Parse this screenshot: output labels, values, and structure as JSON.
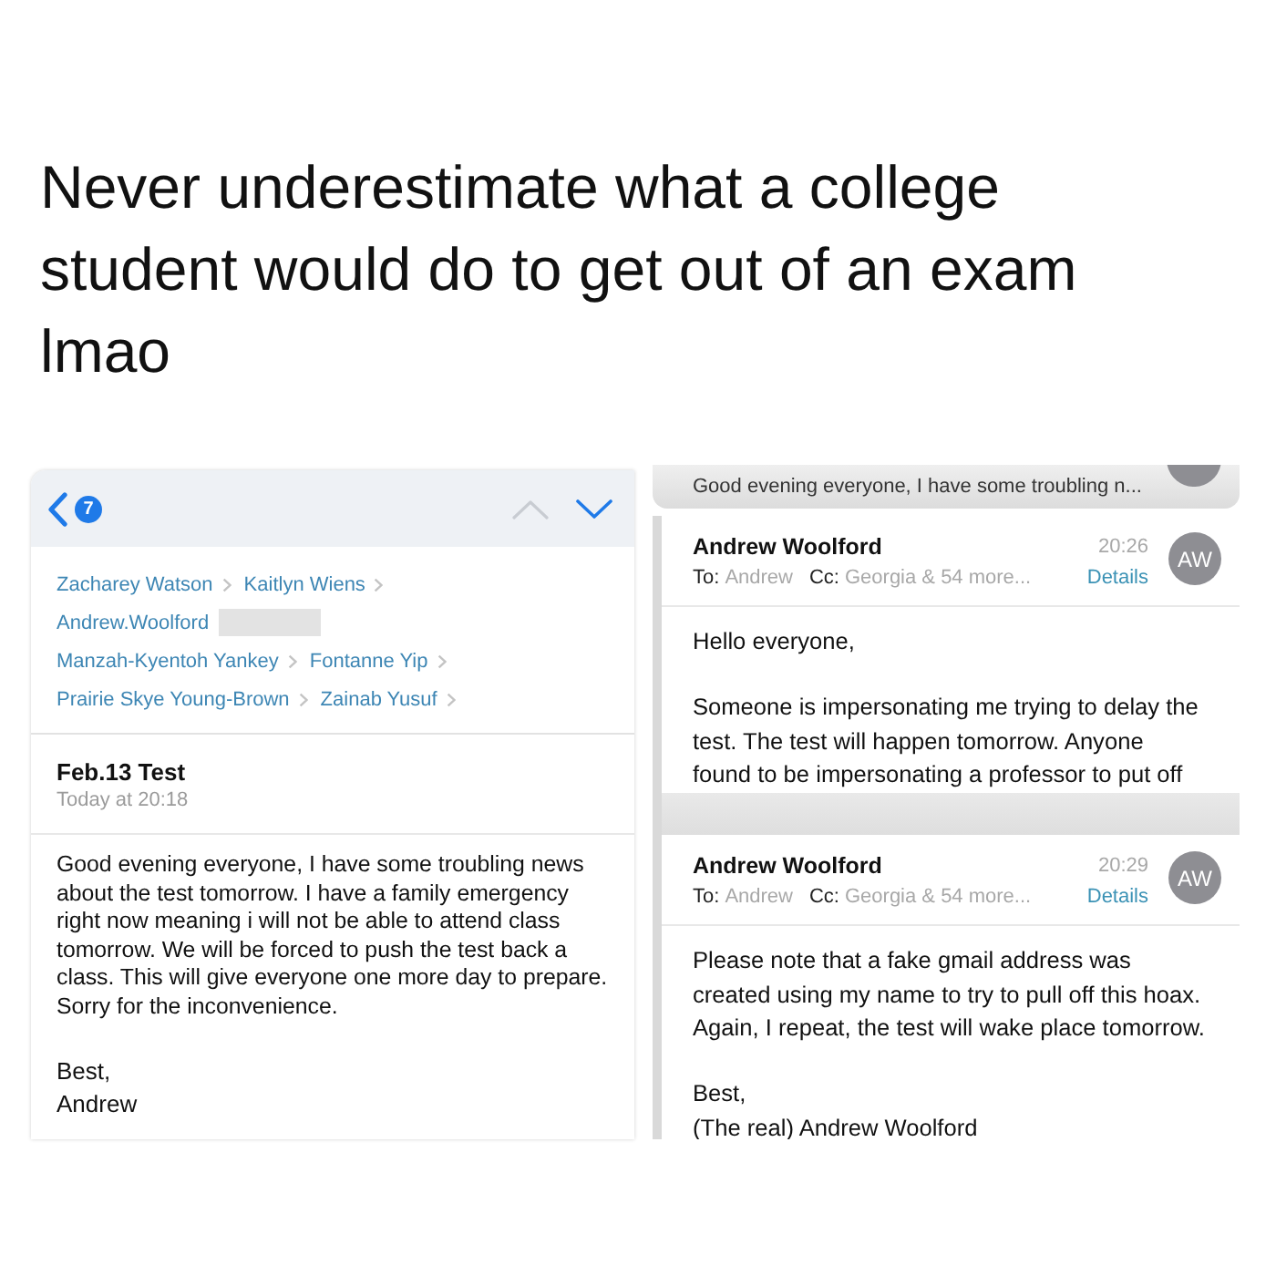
{
  "post": {
    "caption": "Never underestimate what a college student would do to get out of an exam lmao"
  },
  "email": {
    "toolbar": {
      "unread_badge": "7"
    },
    "recipient_rows": [
      {
        "names": [
          {
            "name": "Zacharey Watson",
            "redacted": false
          },
          {
            "name": "Kaitlyn Wiens",
            "redacted": false
          }
        ]
      },
      {
        "names": [
          {
            "name": "Andrew.Woolford",
            "redacted": true
          }
        ]
      },
      {
        "names": [
          {
            "name": "Manzah-Kyentoh Yankey",
            "redacted": false
          },
          {
            "name": "Fontanne Yip",
            "redacted": false
          }
        ]
      },
      {
        "names": [
          {
            "name": "Prairie Skye Young-Brown",
            "redacted": false
          },
          {
            "name": "Zainab Yusuf",
            "redacted": false
          }
        ]
      }
    ],
    "subject": "Feb.13 Test",
    "date": "Today at 20:18",
    "body": [
      "Good evening everyone, I have some troubling news about the test tomorrow. I have a family emergency right now meaning i will not be able to attend class tomorrow. We will be forced to push the test back a class. This will give everyone one more day to prepare. Sorry for the inconvenience."
    ],
    "signoff": [
      "Best,",
      "Andrew"
    ]
  },
  "reply_thread": {
    "collapsed_preview": "Good evening everyone, I have some troubling n...",
    "messages": [
      {
        "sender": "Andrew Woolford",
        "to_label": "To:",
        "to": "Andrew",
        "cc_label": "Cc:",
        "cc": "Georgia & 54 more...",
        "time": "20:26",
        "details": "Details",
        "avatar": "AW",
        "body": [
          "Hello everyone,",
          "Someone is impersonating me trying to delay the test. The test will happen tomorrow. Anyone found to be impersonating a professor to put off"
        ]
      },
      {
        "sender": "Andrew Woolford",
        "to_label": "To:",
        "to": "Andrew",
        "cc_label": "Cc:",
        "cc": "Georgia & 54 more...",
        "time": "20:29",
        "details": "Details",
        "avatar": "AW",
        "body": [
          "Please note that a fake gmail address was created using my name to try to pull off this hoax. Again, I repeat, the test will wake place tomorrow."
        ],
        "signoff": [
          "Best,",
          "(The real) Andrew Woolford"
        ]
      }
    ]
  }
}
